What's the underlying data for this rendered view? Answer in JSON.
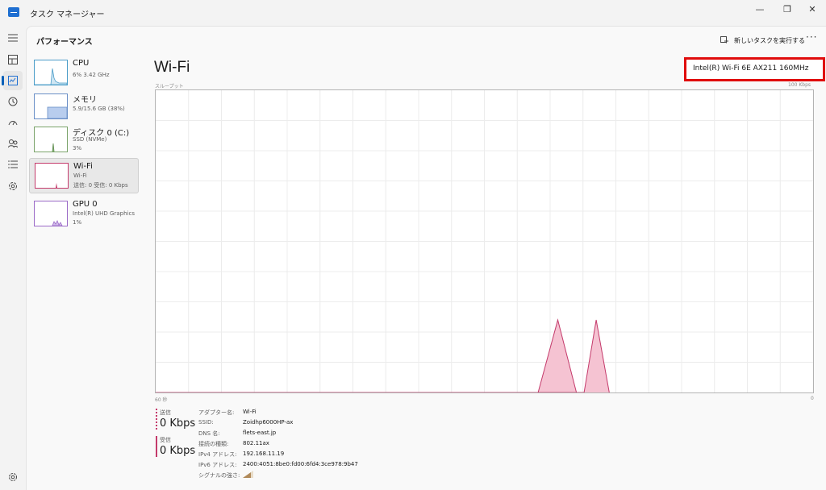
{
  "app": {
    "title": "タスク マネージャー"
  },
  "window_controls": {
    "minimize": "—",
    "maximize": "❐",
    "close": "✕"
  },
  "header": {
    "page_title": "パフォーマンス",
    "run_task_label": "新しいタスクを実行する",
    "more": "···"
  },
  "devices": [
    {
      "name": "CPU",
      "line1": "6% 3.42 GHz",
      "line2": ""
    },
    {
      "name": "メモリ",
      "line1": "5.9/15.6 GB (38%)",
      "line2": ""
    },
    {
      "name": "ディスク 0 (C:)",
      "line1": "SSD (NVMe)",
      "line2": "3%"
    },
    {
      "name": "Wi-Fi",
      "line1": "Wi-Fi",
      "line2": "送信: 0 受信: 0 Kbps"
    },
    {
      "name": "GPU 0",
      "line1": "Intel(R) UHD Graphics",
      "line2": "1%"
    }
  ],
  "detail": {
    "title": "Wi-Fi",
    "adapter": "Intel(R) Wi-Fi 6E AX211 160MHz",
    "throughput_label": "スループット",
    "max_label": "100 Kbps",
    "x_left": "60 秒",
    "x_right": "0"
  },
  "chart_data": {
    "type": "area",
    "xlabel": "",
    "ylabel": "スループット",
    "xlim": [
      60,
      0
    ],
    "ylim": [
      0,
      100
    ],
    "grid": true,
    "series": [
      {
        "name": "送信",
        "color": "#e8a0b4",
        "x": [
          60,
          25.1,
          23.3,
          21.6,
          60
        ],
        "values": [
          0,
          0,
          24,
          0,
          0
        ]
      },
      {
        "name": "受信",
        "color": "#e8a0b4",
        "x": [
          21.6,
          20.9,
          19.8,
          18.6
        ],
        "values": [
          0,
          0,
          24,
          0
        ]
      }
    ]
  },
  "stats": {
    "send_label": "送信",
    "send_value": "0 Kbps",
    "recv_label": "受信",
    "recv_value": "0 Kbps"
  },
  "properties": [
    {
      "label": "アダプター名:",
      "value": "Wi-Fi"
    },
    {
      "label": "SSID:",
      "value": "Zoidhp6000HP-ax"
    },
    {
      "label": "DNS 名:",
      "value": "flets-east.jp"
    },
    {
      "label": "接続の種類:",
      "value": "802.11ax"
    },
    {
      "label": "IPv4 アドレス:",
      "value": "192.168.11.19"
    },
    {
      "label": "IPv6 アドレス:",
      "value": "2400:4051:8be0:fd00:6fd4:3ce978:9b47"
    },
    {
      "label": "シグナルの強さ:",
      "value": ""
    }
  ],
  "signal_strength_bars": 3,
  "colors": {
    "accent": "#005fb8",
    "highlight": "#e00d0d",
    "send_line": "#c43a6b",
    "recv_line": "#c43a6b",
    "chart_fill": "#f5c3d2"
  }
}
